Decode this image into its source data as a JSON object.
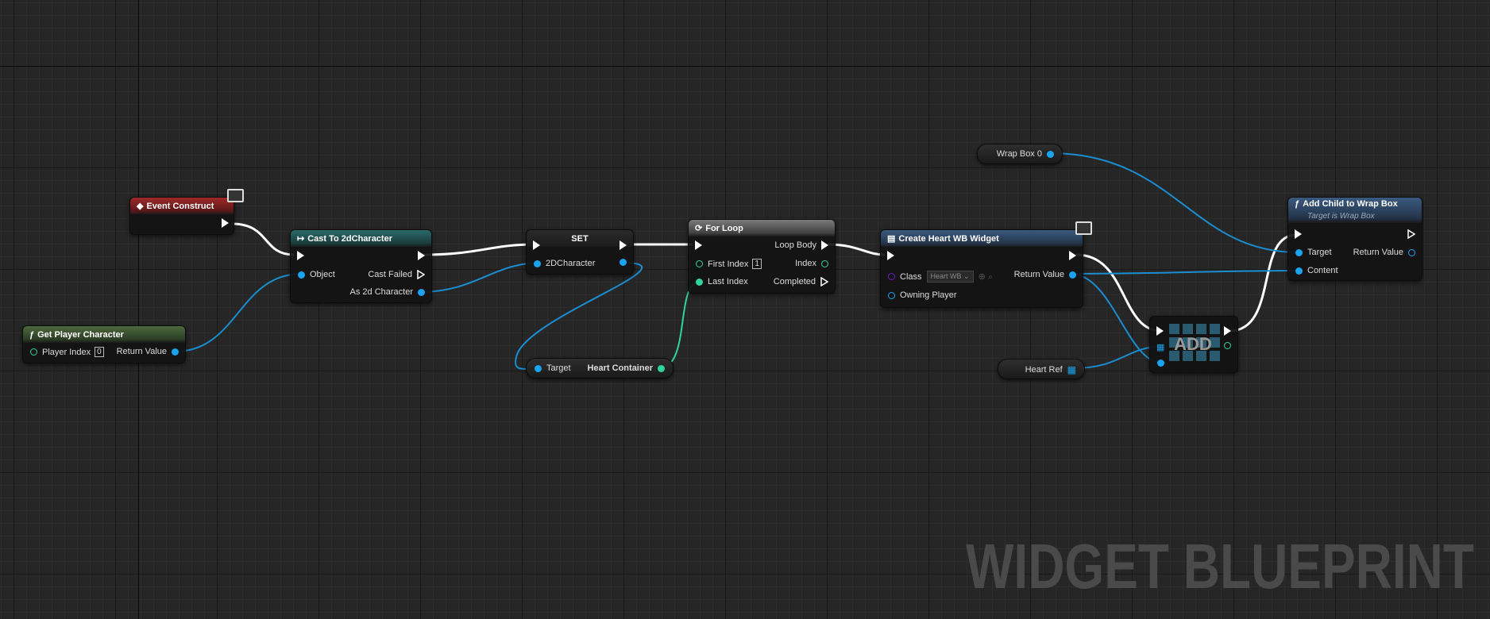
{
  "watermark": "WIDGET BLUEPRINT",
  "nodes": {
    "event_construct": {
      "title": "Event Construct"
    },
    "get_player_character": {
      "title": "Get Player Character",
      "player_index_label": "Player Index",
      "player_index_value": "0",
      "return_value": "Return Value"
    },
    "cast": {
      "title": "Cast To 2dCharacter",
      "object": "Object",
      "cast_failed": "Cast Failed",
      "as_character": "As 2d Character"
    },
    "set": {
      "title": "SET",
      "pin": "2DCharacter"
    },
    "heart_container": {
      "target": "Target",
      "value": "Heart Container"
    },
    "for_loop": {
      "title": "For Loop",
      "first_index": "First Index",
      "first_index_value": "1",
      "last_index": "Last Index",
      "loop_body": "Loop Body",
      "index": "Index",
      "completed": "Completed"
    },
    "create_widget": {
      "title": "Create Heart WB Widget",
      "class_label": "Class",
      "class_value": "Heart WB",
      "owning_player": "Owning Player",
      "return_value": "Return Value"
    },
    "wrap_box": {
      "label": "Wrap Box 0"
    },
    "heart_ref": {
      "label": "Heart Ref"
    },
    "add": {
      "label": "ADD"
    },
    "add_child": {
      "title": "Add Child to Wrap Box",
      "subtitle": "Target is Wrap Box",
      "target": "Target",
      "content": "Content",
      "return_value": "Return Value"
    }
  },
  "colors": {
    "exec": "#ffffff",
    "object_pin": "#1aa4f0",
    "int_pin": "#2fd4a0",
    "class_pin": "#6a1fb8"
  },
  "icons": [
    "event-icon",
    "function-icon",
    "cast-icon",
    "loop-icon",
    "widget-icon",
    "monitor-icon",
    "array-icon"
  ]
}
